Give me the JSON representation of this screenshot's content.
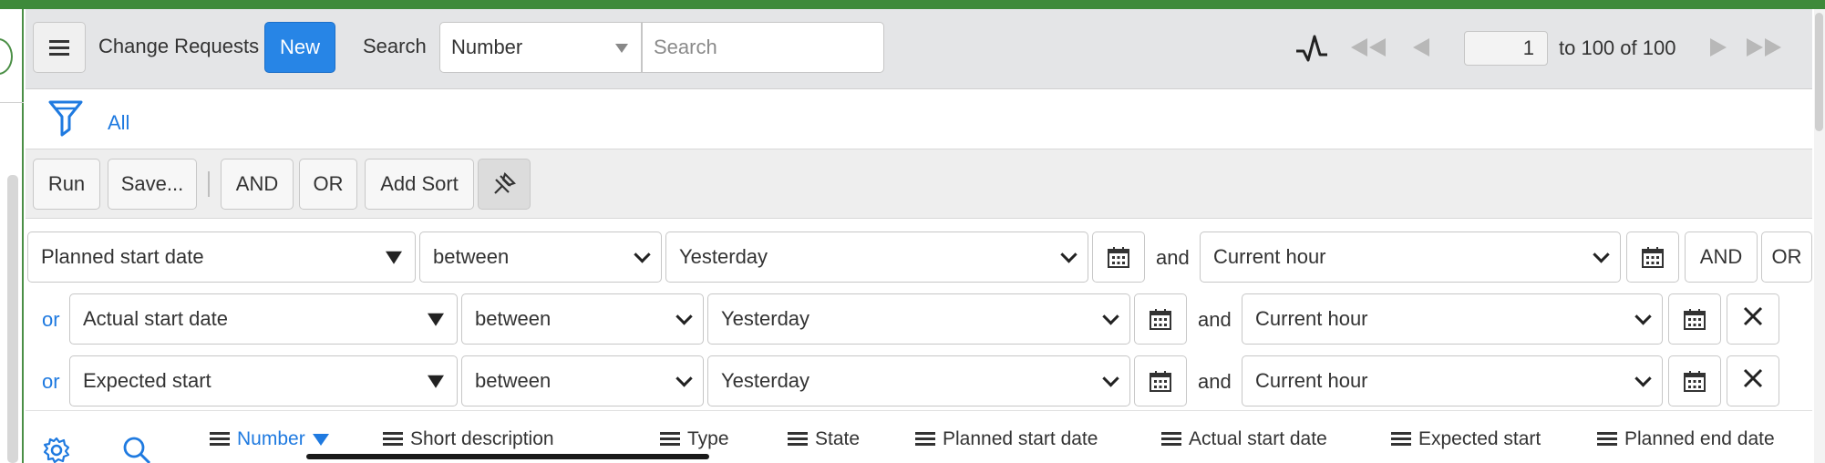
{
  "header": {
    "title": "Change Requests",
    "new_label": "New",
    "search_label": "Search",
    "search_field_selected": "Number",
    "search_placeholder": "Search",
    "page_input_value": "1",
    "page_range": "to 100 of 100"
  },
  "filter": {
    "breadcrumb_all": "All"
  },
  "toolbar": {
    "run": "Run",
    "save": "Save...",
    "and": "AND",
    "or": "OR",
    "add_sort": "Add Sort"
  },
  "conditions": [
    {
      "prefix": "",
      "field": "Planned start date",
      "operator": "between",
      "from": "Yesterday",
      "and_label": "and",
      "to": "Current hour",
      "and_btn": "AND",
      "or_btn": "OR"
    },
    {
      "prefix": "or",
      "field": "Actual start date",
      "operator": "between",
      "from": "Yesterday",
      "and_label": "and",
      "to": "Current hour"
    },
    {
      "prefix": "or",
      "field": "Expected start",
      "operator": "between",
      "from": "Yesterday",
      "and_label": "and",
      "to": "Current hour"
    }
  ],
  "columns": [
    {
      "label": "Number",
      "sorted": true
    },
    {
      "label": "Short description"
    },
    {
      "label": "Type"
    },
    {
      "label": "State"
    },
    {
      "label": "Planned start date"
    },
    {
      "label": "Actual start date"
    },
    {
      "label": "Expected start"
    },
    {
      "label": "Planned end date"
    }
  ],
  "colors": {
    "accent": "#2785e6",
    "link": "#1f7ae0",
    "frame_green": "#3e8a3a"
  },
  "icons": [
    "hamburger-icon",
    "activity-icon",
    "first-page-icon",
    "prev-page-icon",
    "next-page-icon",
    "last-page-icon",
    "filter-icon",
    "pin-icon",
    "calendar-icon",
    "close-icon",
    "gear-icon",
    "search-icon",
    "column-menu-icon",
    "sort-desc-icon"
  ]
}
